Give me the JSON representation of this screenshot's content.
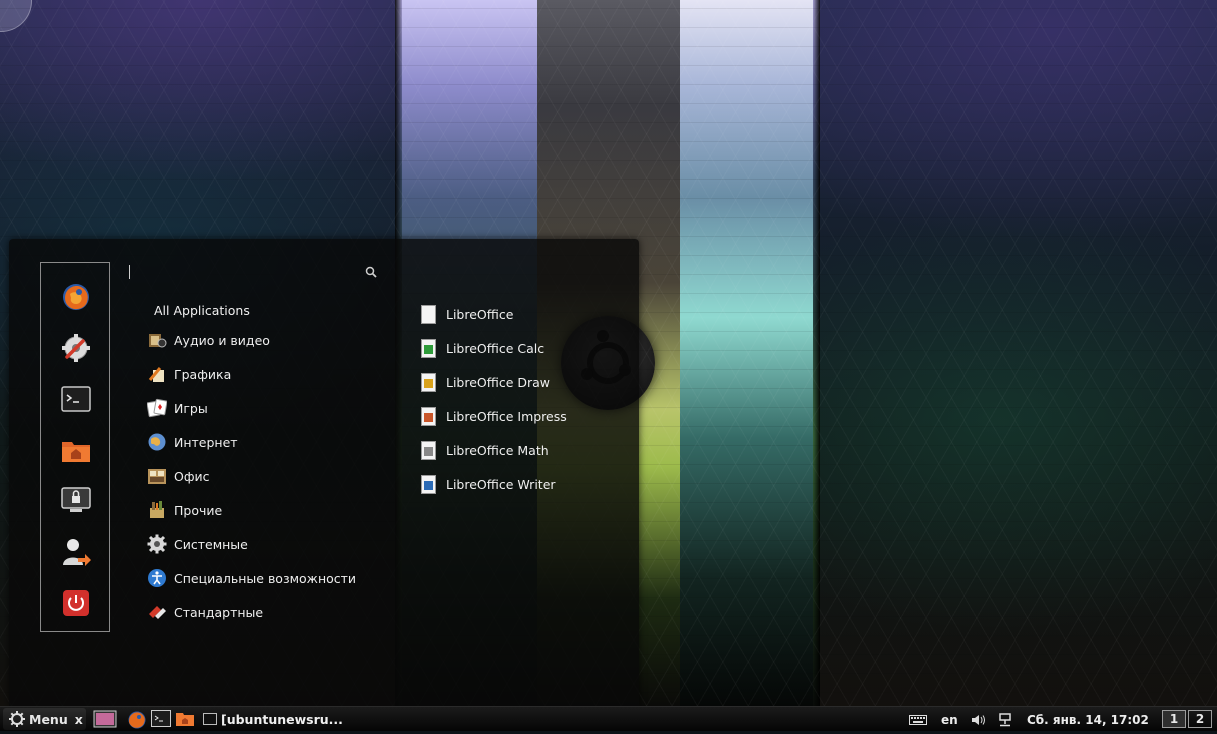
{
  "search": {
    "placeholder": ""
  },
  "favorites": [
    {
      "name": "firefox"
    },
    {
      "name": "system-settings"
    },
    {
      "name": "terminal"
    },
    {
      "name": "home-folder"
    },
    {
      "name": "lock-screen"
    },
    {
      "name": "logout"
    },
    {
      "name": "shutdown"
    }
  ],
  "categories": {
    "all": "All Applications",
    "items": [
      {
        "label": "Аудио и видео",
        "icon": "multimedia-icon"
      },
      {
        "label": "Графика",
        "icon": "graphics-icon"
      },
      {
        "label": "Игры",
        "icon": "games-icon"
      },
      {
        "label": "Интернет",
        "icon": "internet-icon"
      },
      {
        "label": "Офис",
        "icon": "office-icon"
      },
      {
        "label": "Прочие",
        "icon": "other-icon"
      },
      {
        "label": "Системные",
        "icon": "system-icon"
      },
      {
        "label": "Специальные возможности",
        "icon": "accessibility-icon"
      },
      {
        "label": "Стандартные",
        "icon": "accessories-icon"
      }
    ]
  },
  "apps": [
    {
      "label": "LibreOffice",
      "color": "#e0e0e0"
    },
    {
      "label": "LibreOffice Calc",
      "color": "#2e9b3a"
    },
    {
      "label": "LibreOffice Draw",
      "color": "#d9a21b"
    },
    {
      "label": "LibreOffice Impress",
      "color": "#c9562a"
    },
    {
      "label": "LibreOffice Math",
      "color": "#888888"
    },
    {
      "label": "LibreOffice Writer",
      "color": "#2a6ab5"
    }
  ],
  "taskbar": {
    "menu_label": "Menu",
    "menu_suffix": "x",
    "window_title": "[ubuntunewsru...",
    "keyboard_layout": "en",
    "clock": "Сб. янв. 14, 17:02",
    "workspaces": [
      "1",
      "2"
    ]
  }
}
